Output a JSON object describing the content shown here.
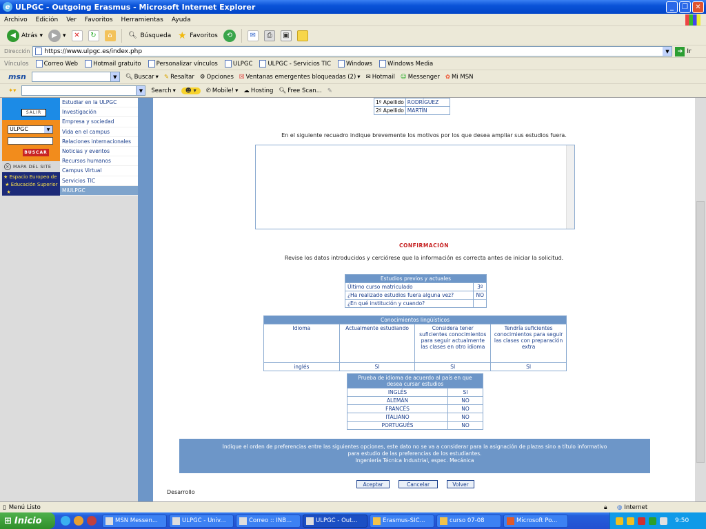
{
  "window": {
    "title": "ULPGC - Outgoing Erasmus - Microsoft Internet Explorer"
  },
  "menu": [
    "Archivo",
    "Edición",
    "Ver",
    "Favoritos",
    "Herramientas",
    "Ayuda"
  ],
  "toolbar": {
    "back": "Atrás",
    "search": "Búsqueda",
    "favorites": "Favoritos"
  },
  "address": {
    "label": "Dirección",
    "url": "https://www.ulpgc.es/index.php",
    "go": "Ir"
  },
  "links": {
    "label": "Vínculos",
    "items": [
      "Correo Web",
      "Hotmail gratuito",
      "Personalizar vínculos",
      "ULPGC",
      "ULPGC - Servicios TIC",
      "Windows",
      "Windows Media"
    ]
  },
  "msnbar": {
    "logo": "msn",
    "buscar": "Buscar",
    "resaltar": "Resaltar",
    "opciones": "Opciones",
    "popups": "Ventanas emergentes bloqueadas (2)",
    "hotmail": "Hotmail",
    "messenger": "Messenger",
    "mimsn": "Mi MSN"
  },
  "searchbar": {
    "search": "Search",
    "mobile": "Mobile!",
    "hosting": "Hosting",
    "freescan": "Free Scan..."
  },
  "left": {
    "salir": "SALIR",
    "select_value": "ULPGC",
    "buscar": "BUSCAR",
    "mapa": "MAPA DEL SITE",
    "eees_line1": "Espacio Europeo de",
    "eees_line2": "Educación Superior",
    "nav": [
      "Estudiar en la ULPGC",
      "Investigación",
      "Empresa y sociedad",
      "Vida en el campus",
      "Relaciones internacionales",
      "Noticias y eventos",
      "Recursos humanos",
      "Campus Virtual",
      "Servicios TIC",
      "MiULPGC"
    ]
  },
  "form": {
    "apellido1_label": "1º Apellido",
    "apellido1_value": "RODRÍGUEZ",
    "apellido2_label": "2º Apellido",
    "apellido2_value": "MARTÍN",
    "motivos_instr": "En el siguiente recuadro indique brevemente los motivos por los que desea ampliar sus estudios fuera.",
    "confirm_title": "CONFIRMACIÓN",
    "confirm_instr": "Revise los datos introducidos y cerciórese que la información es correcta antes de iniciar la solicitud."
  },
  "estudios": {
    "header": "Estudios previos y actuales",
    "rows": [
      [
        "Último curso matriculado",
        "3º"
      ],
      [
        "¿Ha realizado estudios fuera alguna vez?",
        "NO"
      ],
      [
        "¿En qué institución y cuando?",
        ""
      ]
    ]
  },
  "linguisticos": {
    "header": "Conocimientos lingüísticos",
    "cols": [
      "Idioma",
      "Actualmente estudiando",
      "Considera tener suficientes conocimientos para seguir actualmente las clases en otro idioma",
      "Tendría suficientes conocimientos para seguir las clases con preparación extra"
    ],
    "row": [
      "inglés",
      "SI",
      "SI",
      "SI"
    ]
  },
  "prueba": {
    "header": "Prueba de idioma de acuerdo al país en que desea cursar estudios",
    "rows": [
      [
        "INGLÉS",
        "SI"
      ],
      [
        "ALEMÁN",
        "NO"
      ],
      [
        "FRANCÉS",
        "NO"
      ],
      [
        "ITALIANO",
        "NO"
      ],
      [
        "PORTUGUÉS",
        "NO"
      ]
    ]
  },
  "preferencias": {
    "line1": "Indique el orden de preferencias entre las siguientes opciones, este dato no se va a considerar para la asignación de plazas sino a título informativo",
    "line2": "para estudio de las preferencias de los estudiantes.",
    "line3": "Ingeniería Técnica Industrial, espec. Mecánica"
  },
  "buttons": {
    "aceptar": "Aceptar",
    "cancelar": "Cancelar",
    "volver": "Volver"
  },
  "footer": {
    "desarrollo": "Desarrollo"
  },
  "status": {
    "text": "Menú Listo",
    "zone": "Internet"
  },
  "taskbar": {
    "start": "Inicio",
    "tasks": [
      "MSN Messen...",
      "ULPGC - Univ...",
      "Correo :: INB...",
      "ULPGC - Out...",
      "Erasmus-SIC...",
      "curso 07-08",
      "Microsoft Po..."
    ],
    "clock": "9:50"
  }
}
